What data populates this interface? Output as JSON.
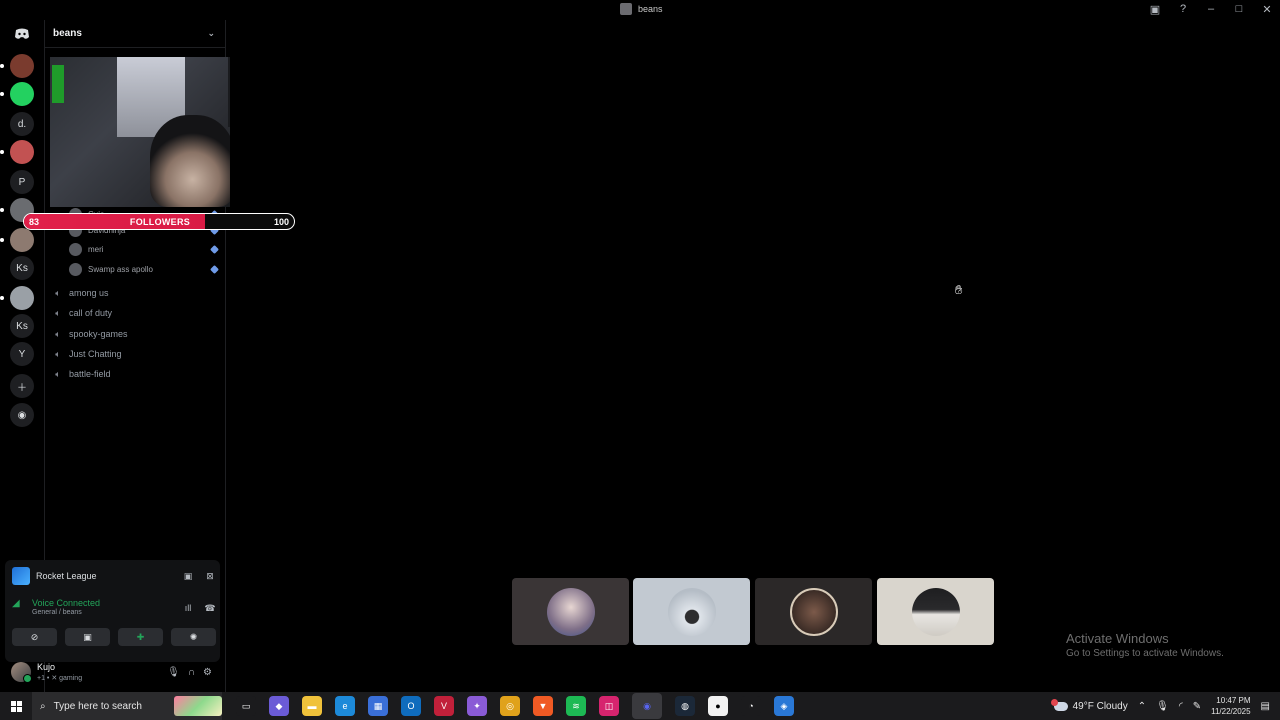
{
  "window": {
    "title": "beans"
  },
  "rail": {
    "servers": [
      {
        "label": "",
        "name": "server-1",
        "color": "#7a3b2e"
      },
      {
        "label": "",
        "name": "server-2",
        "color": "#23d160"
      },
      {
        "label": "d.",
        "name": "server-3",
        "color": "#1e1f22"
      },
      {
        "label": "",
        "name": "server-4",
        "color": "#c25252"
      },
      {
        "label": "P",
        "name": "server-5",
        "color": "#1e1f22"
      },
      {
        "label": "",
        "name": "server-6",
        "color": "#6a6c70"
      },
      {
        "label": "",
        "name": "server-7",
        "color": "#8d7a70"
      },
      {
        "label": "Ks",
        "name": "server-8",
        "color": "#1e1f22"
      },
      {
        "label": "",
        "name": "server-9",
        "color": "#9aa0a6"
      },
      {
        "label": "Ks",
        "name": "server-10",
        "color": "#1e1f22"
      },
      {
        "label": "Y",
        "name": "server-11",
        "color": "#1e1f22"
      }
    ]
  },
  "sidebar": {
    "server_name": "beans",
    "voice_users": [
      "Cujo",
      "Davidninja",
      "meri",
      "Swamp ass apollo"
    ],
    "channels": [
      "among us",
      "call of duty",
      "spooky-games",
      "Just Chatting",
      "battle-field"
    ]
  },
  "followers": {
    "current": "83",
    "label": "FOLLOWERS",
    "goal": "100",
    "progress": 0.83
  },
  "activity": {
    "game": "Rocket League",
    "voice_status": "Voice Connected",
    "voice_channel": "General / beans"
  },
  "user": {
    "name": "Kujo",
    "status": "+1 • ✕ gaming"
  },
  "overlay": {
    "activate_title": "Activate Windows",
    "activate_sub": "Go to Settings to activate Windows."
  },
  "taskbar": {
    "search_placeholder": "Type here to search",
    "weather": "49°F  Cloudy",
    "time": "10:47 PM",
    "date": "11/22/2025",
    "apps": [
      {
        "name": "task-view",
        "color": "#1b1b1d",
        "glyph": "▭"
      },
      {
        "name": "copilot",
        "color": "#6b5bd6",
        "glyph": "◆"
      },
      {
        "name": "file-explorer",
        "color": "#f0c23b",
        "glyph": "▬"
      },
      {
        "name": "edge",
        "color": "#1d8ad9",
        "glyph": "e"
      },
      {
        "name": "store",
        "color": "#3a6fd8",
        "glyph": "▦"
      },
      {
        "name": "outlook",
        "color": "#0f6cbd",
        "glyph": "O"
      },
      {
        "name": "vivaldi",
        "color": "#c1203a",
        "glyph": "V"
      },
      {
        "name": "microsoft-365",
        "color": "#8a5bd6",
        "glyph": "✦"
      },
      {
        "name": "chrome",
        "color": "#e0a21b",
        "glyph": "◎"
      },
      {
        "name": "brave",
        "color": "#f05a24",
        "glyph": "▼"
      },
      {
        "name": "spotify",
        "color": "#1db954",
        "glyph": "≋"
      },
      {
        "name": "instagram",
        "color": "#d6246e",
        "glyph": "◫"
      },
      {
        "name": "discord",
        "color": "#5865f2",
        "glyph": "◉"
      },
      {
        "name": "steam",
        "color": "#1b2838",
        "glyph": "◍"
      },
      {
        "name": "app-panda",
        "color": "#f2f2f2",
        "glyph": "●"
      },
      {
        "name": "app-speed",
        "color": "#1b1b1d",
        "glyph": "◔"
      },
      {
        "name": "rocket-league",
        "color": "#2a78d6",
        "glyph": "◈"
      }
    ]
  }
}
